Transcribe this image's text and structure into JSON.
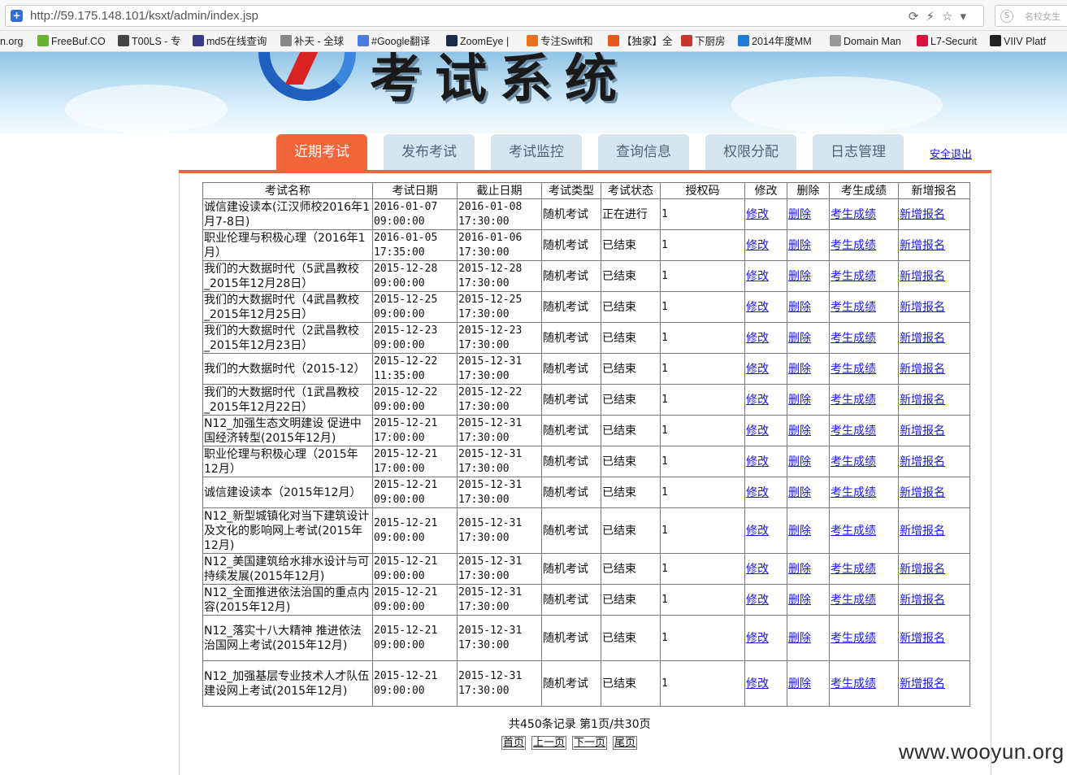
{
  "browser": {
    "url": "http://59.175.148.101/ksxt/admin/index.jsp",
    "side_search_placeholder": "名校女生"
  },
  "bookmarks": [
    {
      "label": "n.org",
      "icon": "none",
      "color": "transparent"
    },
    {
      "label": "FreeBuf.CO",
      "icon": "freebuf-icon",
      "color": "#68b230"
    },
    {
      "label": "T00LS - 专",
      "icon": "tools-icon",
      "color": "#444444"
    },
    {
      "label": "md5在线查询",
      "icon": "grid-icon",
      "color": "#3a3a8c"
    },
    {
      "label": "补天 - 全球",
      "icon": "star-icon",
      "color": "#888888"
    },
    {
      "label": "#Google翻译",
      "icon": "translate-icon",
      "color": "#4a7be0"
    },
    {
      "label": "ZoomEye |",
      "icon": "eye-icon",
      "color": "#1b2b4c"
    },
    {
      "label": "专注Swift和",
      "icon": "swift-icon",
      "color": "#e8731c"
    },
    {
      "label": "【独家】全",
      "icon": "bird-icon",
      "color": "#e85a1c"
    },
    {
      "label": "下厨房",
      "icon": "kitchen-icon",
      "color": "#c8372d"
    },
    {
      "label": "2014年度MM",
      "icon": "play-icon",
      "color": "#1e7bd6"
    },
    {
      "label": "Domain Man",
      "icon": "page-icon",
      "color": "#999999"
    },
    {
      "label": "L7-Securit",
      "icon": "ring-icon",
      "color": "#d8123a"
    },
    {
      "label": "VIIV Platf",
      "icon": "code-icon",
      "color": "#222222"
    }
  ],
  "header": {
    "title": "考试系统"
  },
  "tabs": [
    {
      "label": "近期考试",
      "active": true
    },
    {
      "label": "发布考试",
      "active": false
    },
    {
      "label": "考试监控",
      "active": false
    },
    {
      "label": "查询信息",
      "active": false
    },
    {
      "label": "权限分配",
      "active": false
    },
    {
      "label": "日志管理",
      "active": false
    }
  ],
  "logout_label": "安全退出",
  "table": {
    "columns": [
      "考试名称",
      "考试日期",
      "截止日期",
      "考试类型",
      "考试状态",
      "授权码",
      "修改",
      "删除",
      "考生成绩",
      "新增报名"
    ],
    "rows": [
      {
        "name": "诚信建设读本(江汉师校2016年1月7-8日)",
        "start": "2016-01-07 09:00:00",
        "end": "2016-01-08 17:30:00",
        "type": "随机考试",
        "status": "正在进行",
        "code": "1"
      },
      {
        "name": "职业伦理与积极心理（2016年1月）",
        "start": "2016-01-05 17:35:00",
        "end": "2016-01-06 17:30:00",
        "type": "随机考试",
        "status": "已结束",
        "code": "1"
      },
      {
        "name": "我们的大数据时代（5武昌教校_2015年12月28日）",
        "start": "2015-12-28 09:00:00",
        "end": "2015-12-28 17:30:00",
        "type": "随机考试",
        "status": "已结束",
        "code": "1"
      },
      {
        "name": "我们的大数据时代（4武昌教校_2015年12月25日）",
        "start": "2015-12-25 09:00:00",
        "end": "2015-12-25 17:30:00",
        "type": "随机考试",
        "status": "已结束",
        "code": "1"
      },
      {
        "name": "我们的大数据时代（2武昌教校_2015年12月23日）",
        "start": "2015-12-23 09:00:00",
        "end": "2015-12-23 17:30:00",
        "type": "随机考试",
        "status": "已结束",
        "code": "1"
      },
      {
        "name": "我们的大数据时代（2015-12）",
        "start": "2015-12-22 11:35:00",
        "end": "2015-12-31 17:30:00",
        "type": "随机考试",
        "status": "已结束",
        "code": "1"
      },
      {
        "name": "我们的大数据时代（1武昌教校_2015年12月22日）",
        "start": "2015-12-22 09:00:00",
        "end": "2015-12-22 17:30:00",
        "type": "随机考试",
        "status": "已结束",
        "code": "1"
      },
      {
        "name": "N12_加强生态文明建设 促进中国经济转型(2015年12月)",
        "start": "2015-12-21 17:00:00",
        "end": "2015-12-31 17:30:00",
        "type": "随机考试",
        "status": "已结束",
        "code": "1"
      },
      {
        "name": "职业伦理与积极心理（2015年12月）",
        "start": "2015-12-21 17:00:00",
        "end": "2015-12-31 17:30:00",
        "type": "随机考试",
        "status": "已结束",
        "code": "1"
      },
      {
        "name": "诚信建设读本（2015年12月）",
        "start": "2015-12-21 09:00:00",
        "end": "2015-12-31 17:30:00",
        "type": "随机考试",
        "status": "已结束",
        "code": "1"
      },
      {
        "name": "N12_新型城镇化对当下建筑设计及文化的影响网上考试(2015年12月)",
        "start": "2015-12-21 09:00:00",
        "end": "2015-12-31 17:30:00",
        "type": "随机考试",
        "status": "已结束",
        "code": "1"
      },
      {
        "name": "N12_美国建筑给水排水设计与可持续发展(2015年12月)",
        "start": "2015-12-21 09:00:00",
        "end": "2015-12-31 17:30:00",
        "type": "随机考试",
        "status": "已结束",
        "code": "1"
      },
      {
        "name": "N12_全面推进依法治国的重点内容(2015年12月)",
        "start": "2015-12-21 09:00:00",
        "end": "2015-12-31 17:30:00",
        "type": "随机考试",
        "status": "已结束",
        "code": "1"
      },
      {
        "name": "N12_落实十八大精神 推进依法治国网上考试(2015年12月)",
        "start": "2015-12-21 09:00:00",
        "end": "2015-12-31 17:30:00",
        "type": "随机考试",
        "status": "已结束",
        "code": "1"
      },
      {
        "name": "N12_加强基层专业技术人才队伍建设网上考试(2015年12月)",
        "start": "2015-12-21 09:00:00",
        "end": "2015-12-31 17:30:00",
        "type": "随机考试",
        "status": "已结束",
        "code": "1"
      }
    ],
    "link_labels": {
      "edit": "修改",
      "delete": "删除",
      "scores": "考生成绩",
      "add": "新增报名"
    }
  },
  "pagination": {
    "summary": "共450条记录 第1页/共30页",
    "first": "首页",
    "prev": "上一页",
    "next": "下一页",
    "last": "尾页"
  },
  "watermark": "www.wooyun.org"
}
